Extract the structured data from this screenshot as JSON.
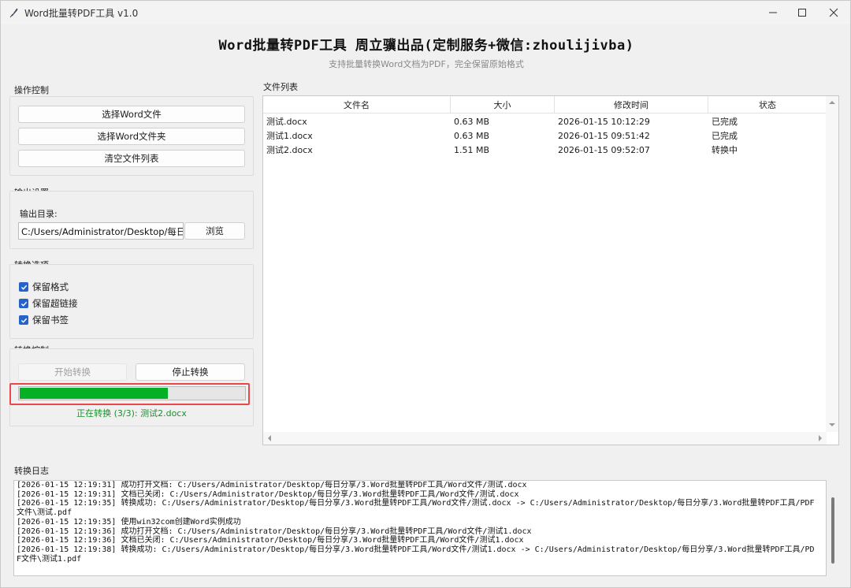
{
  "window": {
    "title": "Word批量转PDF工具 v1.0"
  },
  "header": {
    "title": "Word批量转PDF工具 周立骥出品(定制服务+微信:zhoulijivba)",
    "subtitle": "支持批量转换Word文档为PDF，完全保留原始格式"
  },
  "operation": {
    "label": "操作控制",
    "select_files": "选择Word文件",
    "select_folder": "选择Word文件夹",
    "clear_list": "清空文件列表"
  },
  "output": {
    "label": "输出设置",
    "dir_label": "输出目录:",
    "dir_value": "C:/Users/Administrator/Desktop/每日分",
    "browse": "浏览"
  },
  "options": {
    "label": "转换选项",
    "items": [
      {
        "label": "保留格式",
        "checked": true
      },
      {
        "label": "保留超链接",
        "checked": true
      },
      {
        "label": "保留书签",
        "checked": true
      }
    ]
  },
  "control": {
    "label": "转换控制",
    "start": "开始转换",
    "stop": "停止转换",
    "progress": 0.66,
    "status": "正在转换 (3/3): 测试2.docx"
  },
  "filelist": {
    "label": "文件列表",
    "columns": [
      "文件名",
      "大小",
      "修改时间",
      "状态"
    ],
    "rows": [
      [
        "测试.docx",
        "0.63 MB",
        "2026-01-15 10:12:29",
        "已完成"
      ],
      [
        "测试1.docx",
        "0.63 MB",
        "2026-01-15 09:51:42",
        "已完成"
      ],
      [
        "测试2.docx",
        "1.51 MB",
        "2026-01-15 09:52:07",
        "转换中"
      ]
    ]
  },
  "log": {
    "label": "转换日志",
    "lines": [
      "[2026-01-15 12:19:31] 成功打开文档: C:/Users/Administrator/Desktop/每日分享/3.Word批量转PDF工具/Word文件/测试.docx",
      "[2026-01-15 12:19:31] 文档已关闭: C:/Users/Administrator/Desktop/每日分享/3.Word批量转PDF工具/Word文件/测试.docx",
      "[2026-01-15 12:19:35] 转换成功: C:/Users/Administrator/Desktop/每日分享/3.Word批量转PDF工具/Word文件/测试.docx -> C:/Users/Administrator/Desktop/每日分享/3.Word批量转PDF工具/PDF文件\\测试.pdf",
      "[2026-01-15 12:19:35] 使用win32com创建Word实例成功",
      "[2026-01-15 12:19:36] 成功打开文档: C:/Users/Administrator/Desktop/每日分享/3.Word批量转PDF工具/Word文件/测试1.docx",
      "[2026-01-15 12:19:36] 文档已关闭: C:/Users/Administrator/Desktop/每日分享/3.Word批量转PDF工具/Word文件/测试1.docx",
      "[2026-01-15 12:19:38] 转换成功: C:/Users/Administrator/Desktop/每日分享/3.Word批量转PDF工具/Word文件/测试1.docx -> C:/Users/Administrator/Desktop/每日分享/3.Word批量转PDF工具/PDF文件\\测试1.pdf"
    ]
  }
}
